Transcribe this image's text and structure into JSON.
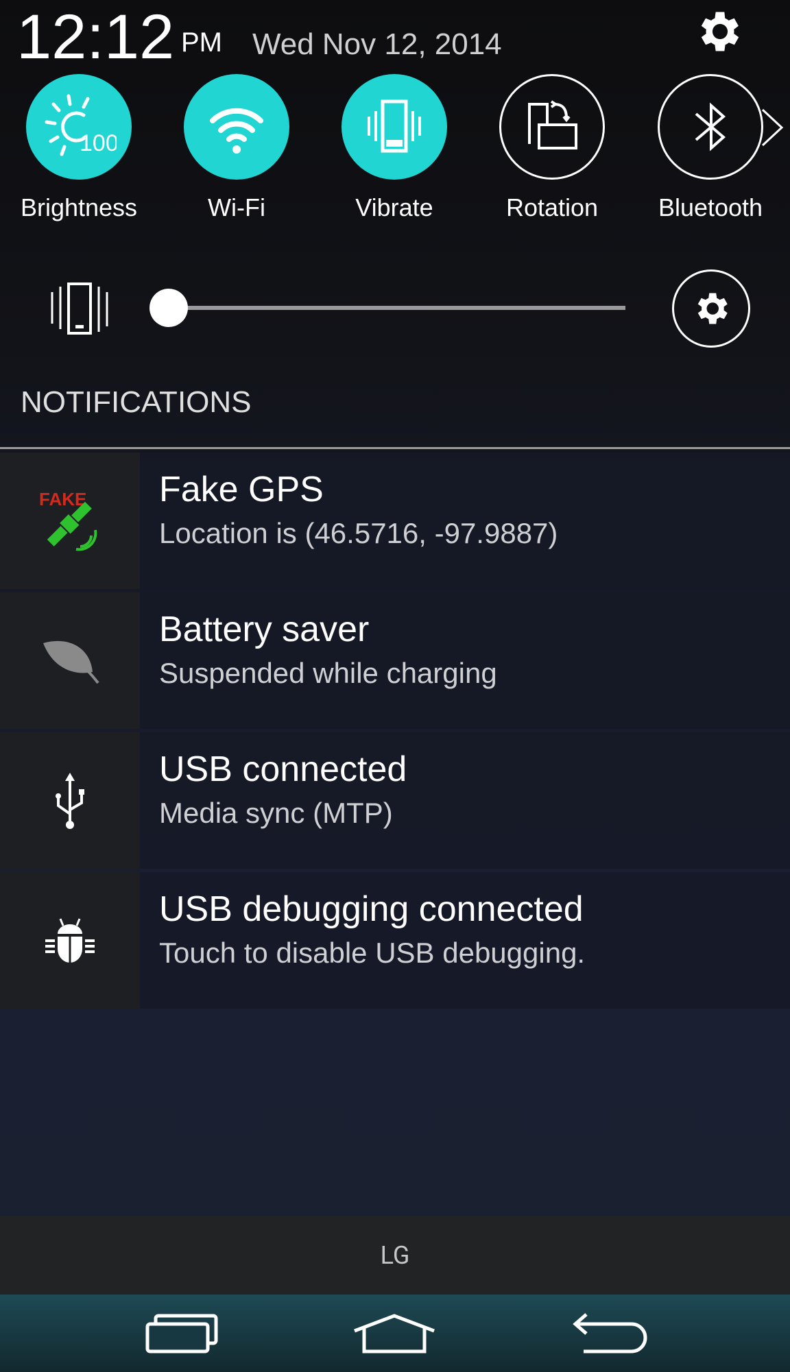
{
  "status": {
    "time": "12:12",
    "ampm": "PM",
    "date": "Wed Nov 12, 2014",
    "settings_icon": "gear-icon"
  },
  "quick_settings": [
    {
      "label": "Brightness",
      "icon": "brightness-icon",
      "badge": "100",
      "active": true
    },
    {
      "label": "Wi-Fi",
      "icon": "wifi-icon",
      "active": true
    },
    {
      "label": "Vibrate",
      "icon": "vibrate-icon",
      "active": true
    },
    {
      "label": "Rotation",
      "icon": "rotation-icon",
      "active": false
    },
    {
      "label": "Bluetooth",
      "icon": "bluetooth-icon",
      "active": false
    }
  ],
  "volume": {
    "mode_icon": "vibrate-icon",
    "level_percent": 0,
    "settings_icon": "gear-icon"
  },
  "notifications_header": "NOTIFICATIONS",
  "notifications": [
    {
      "title": "Fake GPS",
      "subtitle": "Location is (46.5716, -97.9887)",
      "icon": "fake-gps-icon",
      "icon_text": "FAKE"
    },
    {
      "title": "Battery saver",
      "subtitle": "Suspended while charging",
      "icon": "leaf-icon"
    },
    {
      "title": "USB connected",
      "subtitle": "Media sync (MTP)",
      "icon": "usb-icon"
    },
    {
      "title": "USB debugging connected",
      "subtitle": "Touch to disable USB debugging.",
      "icon": "android-debug-icon"
    }
  ],
  "carrier_label": "LG",
  "colors": {
    "accent": "#20d5d2"
  }
}
